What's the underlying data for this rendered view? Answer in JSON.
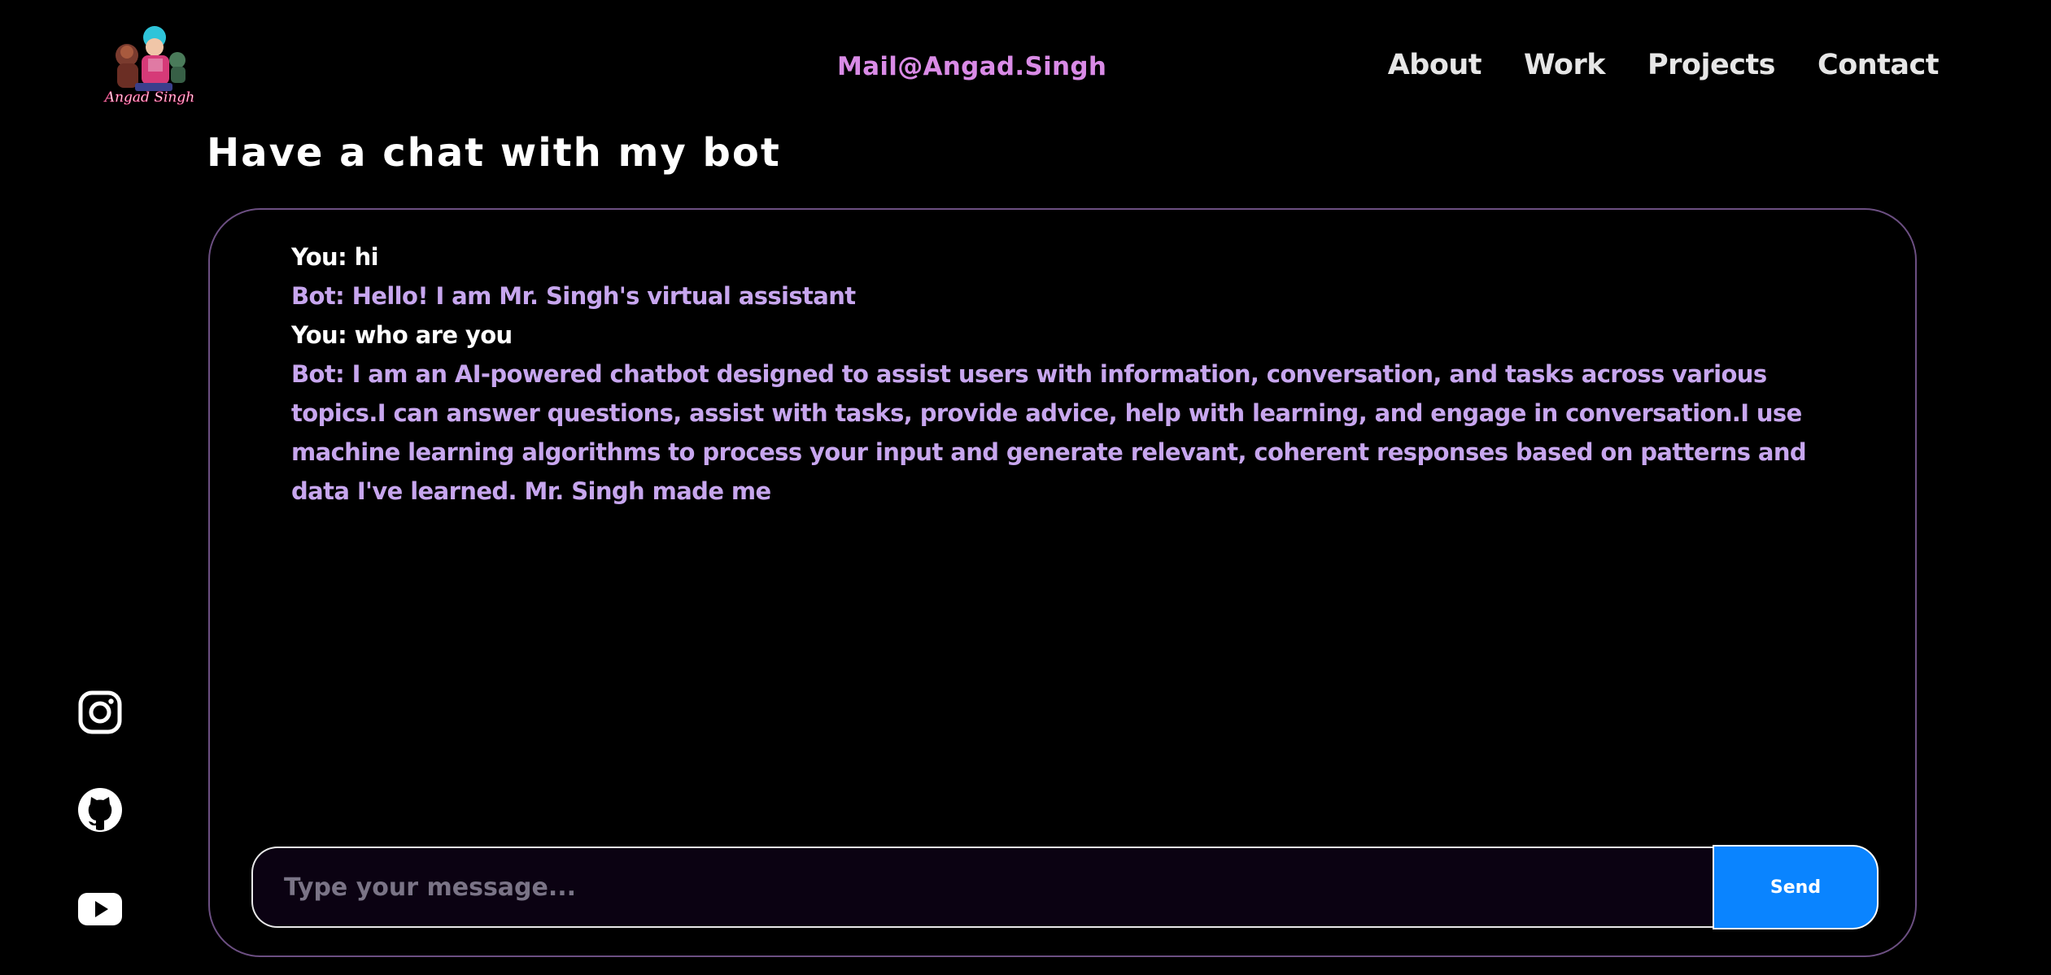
{
  "header": {
    "mail": "Mail@Angad.Singh",
    "nav": [
      {
        "label": "About"
      },
      {
        "label": "Work"
      },
      {
        "label": "Projects"
      },
      {
        "label": "Contact"
      }
    ],
    "logo_icon": "avatar-logo"
  },
  "main": {
    "title": "Have a chat with my bot"
  },
  "chat": {
    "messages": [
      {
        "role": "user",
        "text": "You: hi"
      },
      {
        "role": "bot",
        "text": "Bot: Hello! I am Mr. Singh's virtual assistant"
      },
      {
        "role": "user",
        "text": "You: who are you"
      },
      {
        "role": "bot",
        "text": "Bot: I am an AI-powered chatbot designed to assist users with information, conversation, and tasks across various topics.I can answer questions, assist with tasks, provide advice, help with learning, and engage in conversation.I use machine learning algorithms to process your input and generate relevant, coherent responses based on patterns and data I've learned. Mr. Singh made me"
      }
    ],
    "input": {
      "value": "",
      "placeholder": "Type your message..."
    },
    "send_label": "Send"
  },
  "social": [
    {
      "icon": "instagram-icon"
    },
    {
      "icon": "github-icon"
    },
    {
      "icon": "youtube-icon"
    }
  ],
  "colors": {
    "background": "#000000",
    "mail": "#d98be6",
    "bot_text": "#c7a6ee",
    "user_text": "#ffffff",
    "send_button": "#0a84ff",
    "chat_border": "#6c4f82"
  }
}
